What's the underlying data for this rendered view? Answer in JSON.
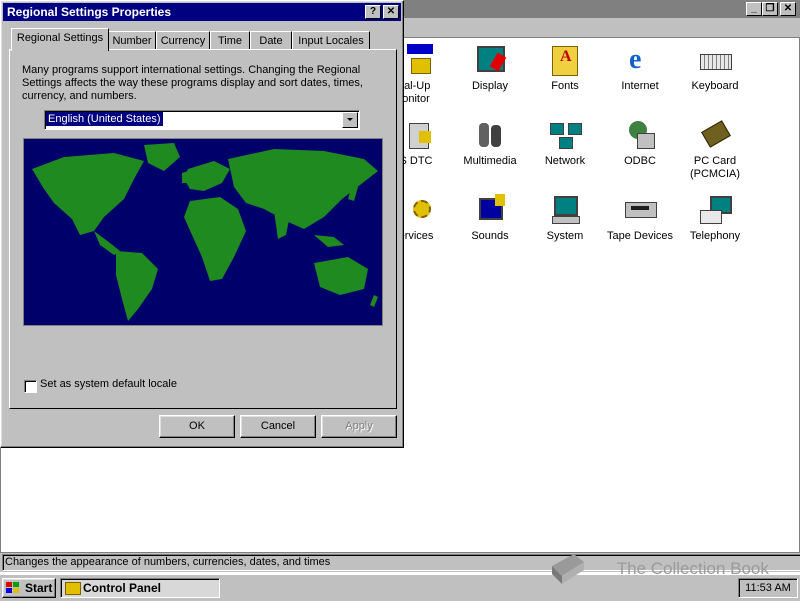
{
  "dialog": {
    "title": "Regional Settings Properties",
    "help_btn": "?",
    "close_btn": "✕",
    "tabs": [
      "Regional Settings",
      "Number",
      "Currency",
      "Time",
      "Date",
      "Input Locales"
    ],
    "intro_text": "Many programs support international settings. Changing the Regional Settings affects the way these programs display and sort dates, times, currency, and numbers.",
    "locale": "English (United States)",
    "default_checkbox_label": "Set as system default locale",
    "buttons": {
      "ok": "OK",
      "cancel": "Cancel",
      "apply": "Apply"
    }
  },
  "control_panel": {
    "icons": [
      {
        "label": "ial-Up\nonitor",
        "icon": "dialup-icon"
      },
      {
        "label": "Display",
        "icon": "display-icon"
      },
      {
        "label": "Fonts",
        "icon": "fonts-icon"
      },
      {
        "label": "Internet",
        "icon": "internet-icon"
      },
      {
        "label": "Keyboard",
        "icon": "keyboard-icon"
      },
      {
        "label": "S DTC",
        "icon": "dtc-icon"
      },
      {
        "label": "Multimedia",
        "icon": "multimedia-icon"
      },
      {
        "label": "Network",
        "icon": "network-icon"
      },
      {
        "label": "ODBC",
        "icon": "odbc-icon"
      },
      {
        "label": "PC Card\n(PCMCIA)",
        "icon": "pccard-icon"
      },
      {
        "label": "ervices",
        "icon": "services-icon"
      },
      {
        "label": "Sounds",
        "icon": "sounds-icon"
      },
      {
        "label": "System",
        "icon": "system-icon"
      },
      {
        "label": "Tape Devices",
        "icon": "tape-icon"
      },
      {
        "label": "Telephony",
        "icon": "telephony-icon"
      }
    ],
    "status": "Changes the appearance of numbers, currencies, dates, and times"
  },
  "taskbar": {
    "start": "Start",
    "task": "Control Panel",
    "clock": "11:53 AM"
  },
  "watermark": "The Collection Book",
  "colors": {
    "title_active": "#000080",
    "face": "#c0c0c0",
    "ocean": "#00006a",
    "land": "#1f8a1f"
  }
}
